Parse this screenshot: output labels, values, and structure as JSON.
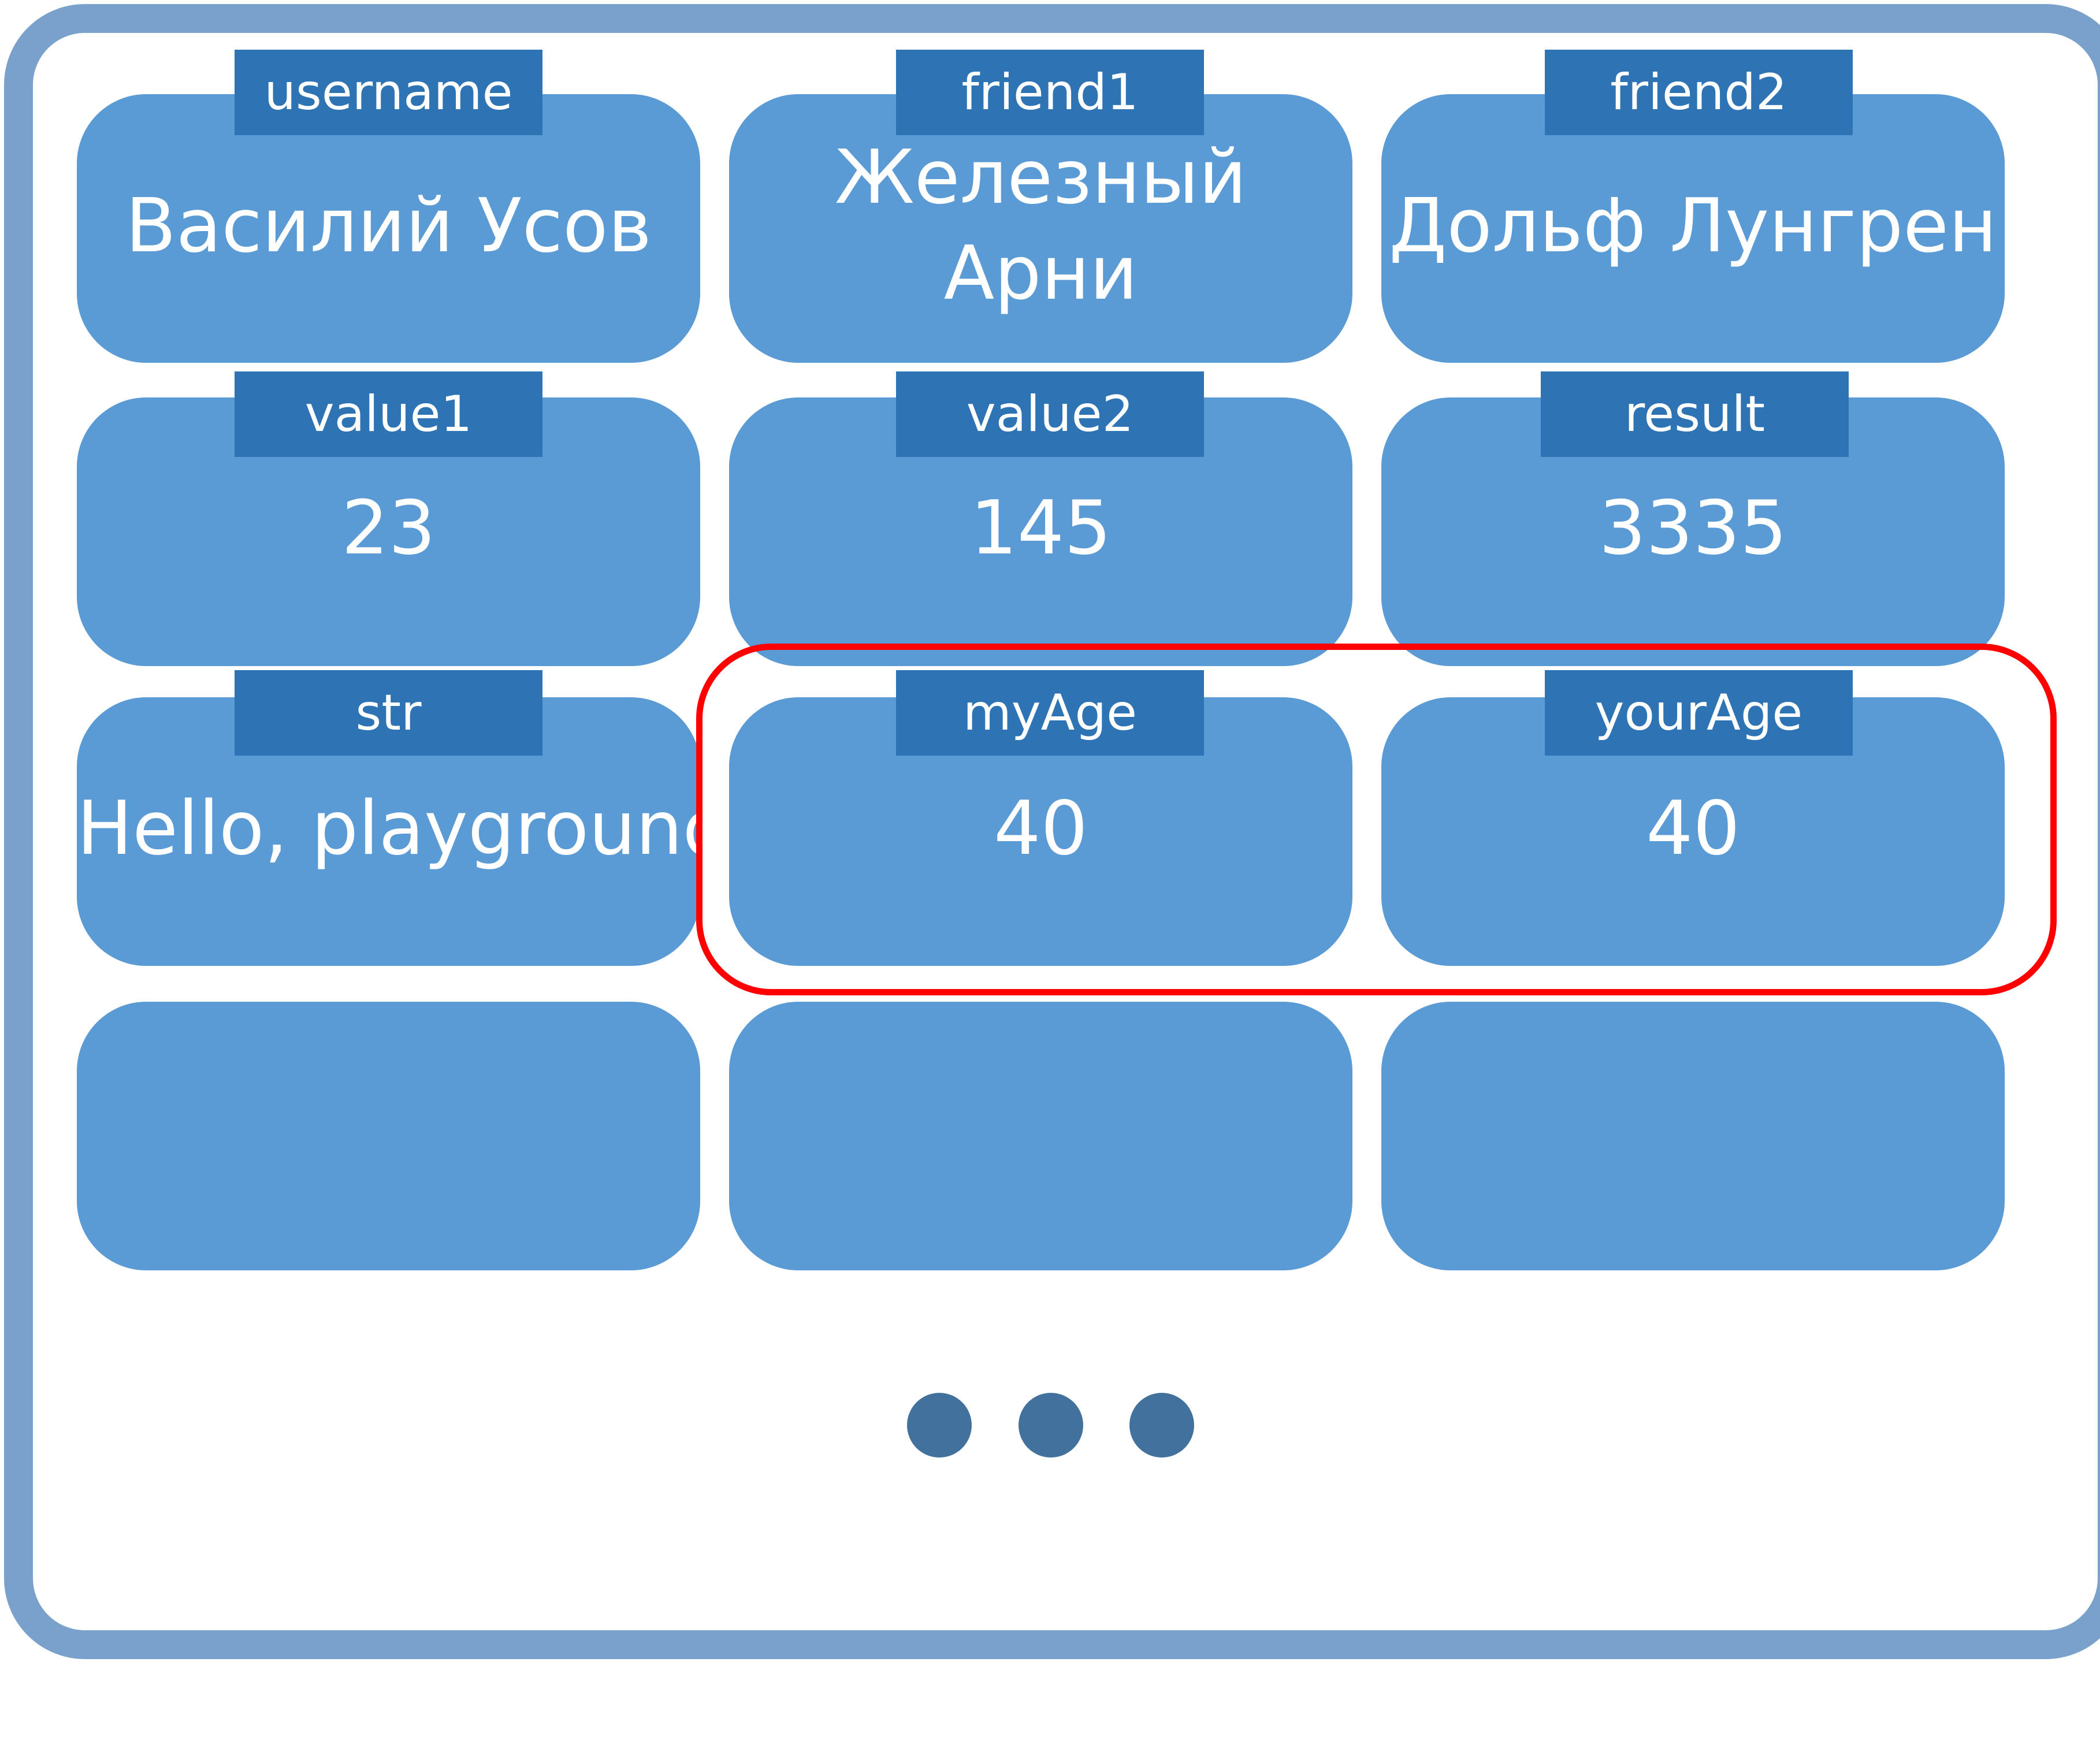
{
  "cells": [
    {
      "name": "username",
      "value": "Василий Усов"
    },
    {
      "name": "friend1",
      "value_line1": "Железный",
      "value_line2": "Арни"
    },
    {
      "name": "friend2",
      "value": "Дольф Лунгрен"
    },
    {
      "name": "value1",
      "value": "23"
    },
    {
      "name": "value2",
      "value": "145"
    },
    {
      "name": "result",
      "value": "3335"
    },
    {
      "name": "str",
      "value": "Hello, playground"
    },
    {
      "name": "myAge",
      "value": "40"
    },
    {
      "name": "yourAge",
      "value": "40"
    }
  ],
  "colors": {
    "frame": "#7aa1cc",
    "cell_fill": "#5b9bd5",
    "label_fill": "#2e74b5",
    "highlight": "#ff0000",
    "ellipsis_dots": "#41719c"
  },
  "ellipsis": {
    "icon": "ellipsis-icon"
  }
}
